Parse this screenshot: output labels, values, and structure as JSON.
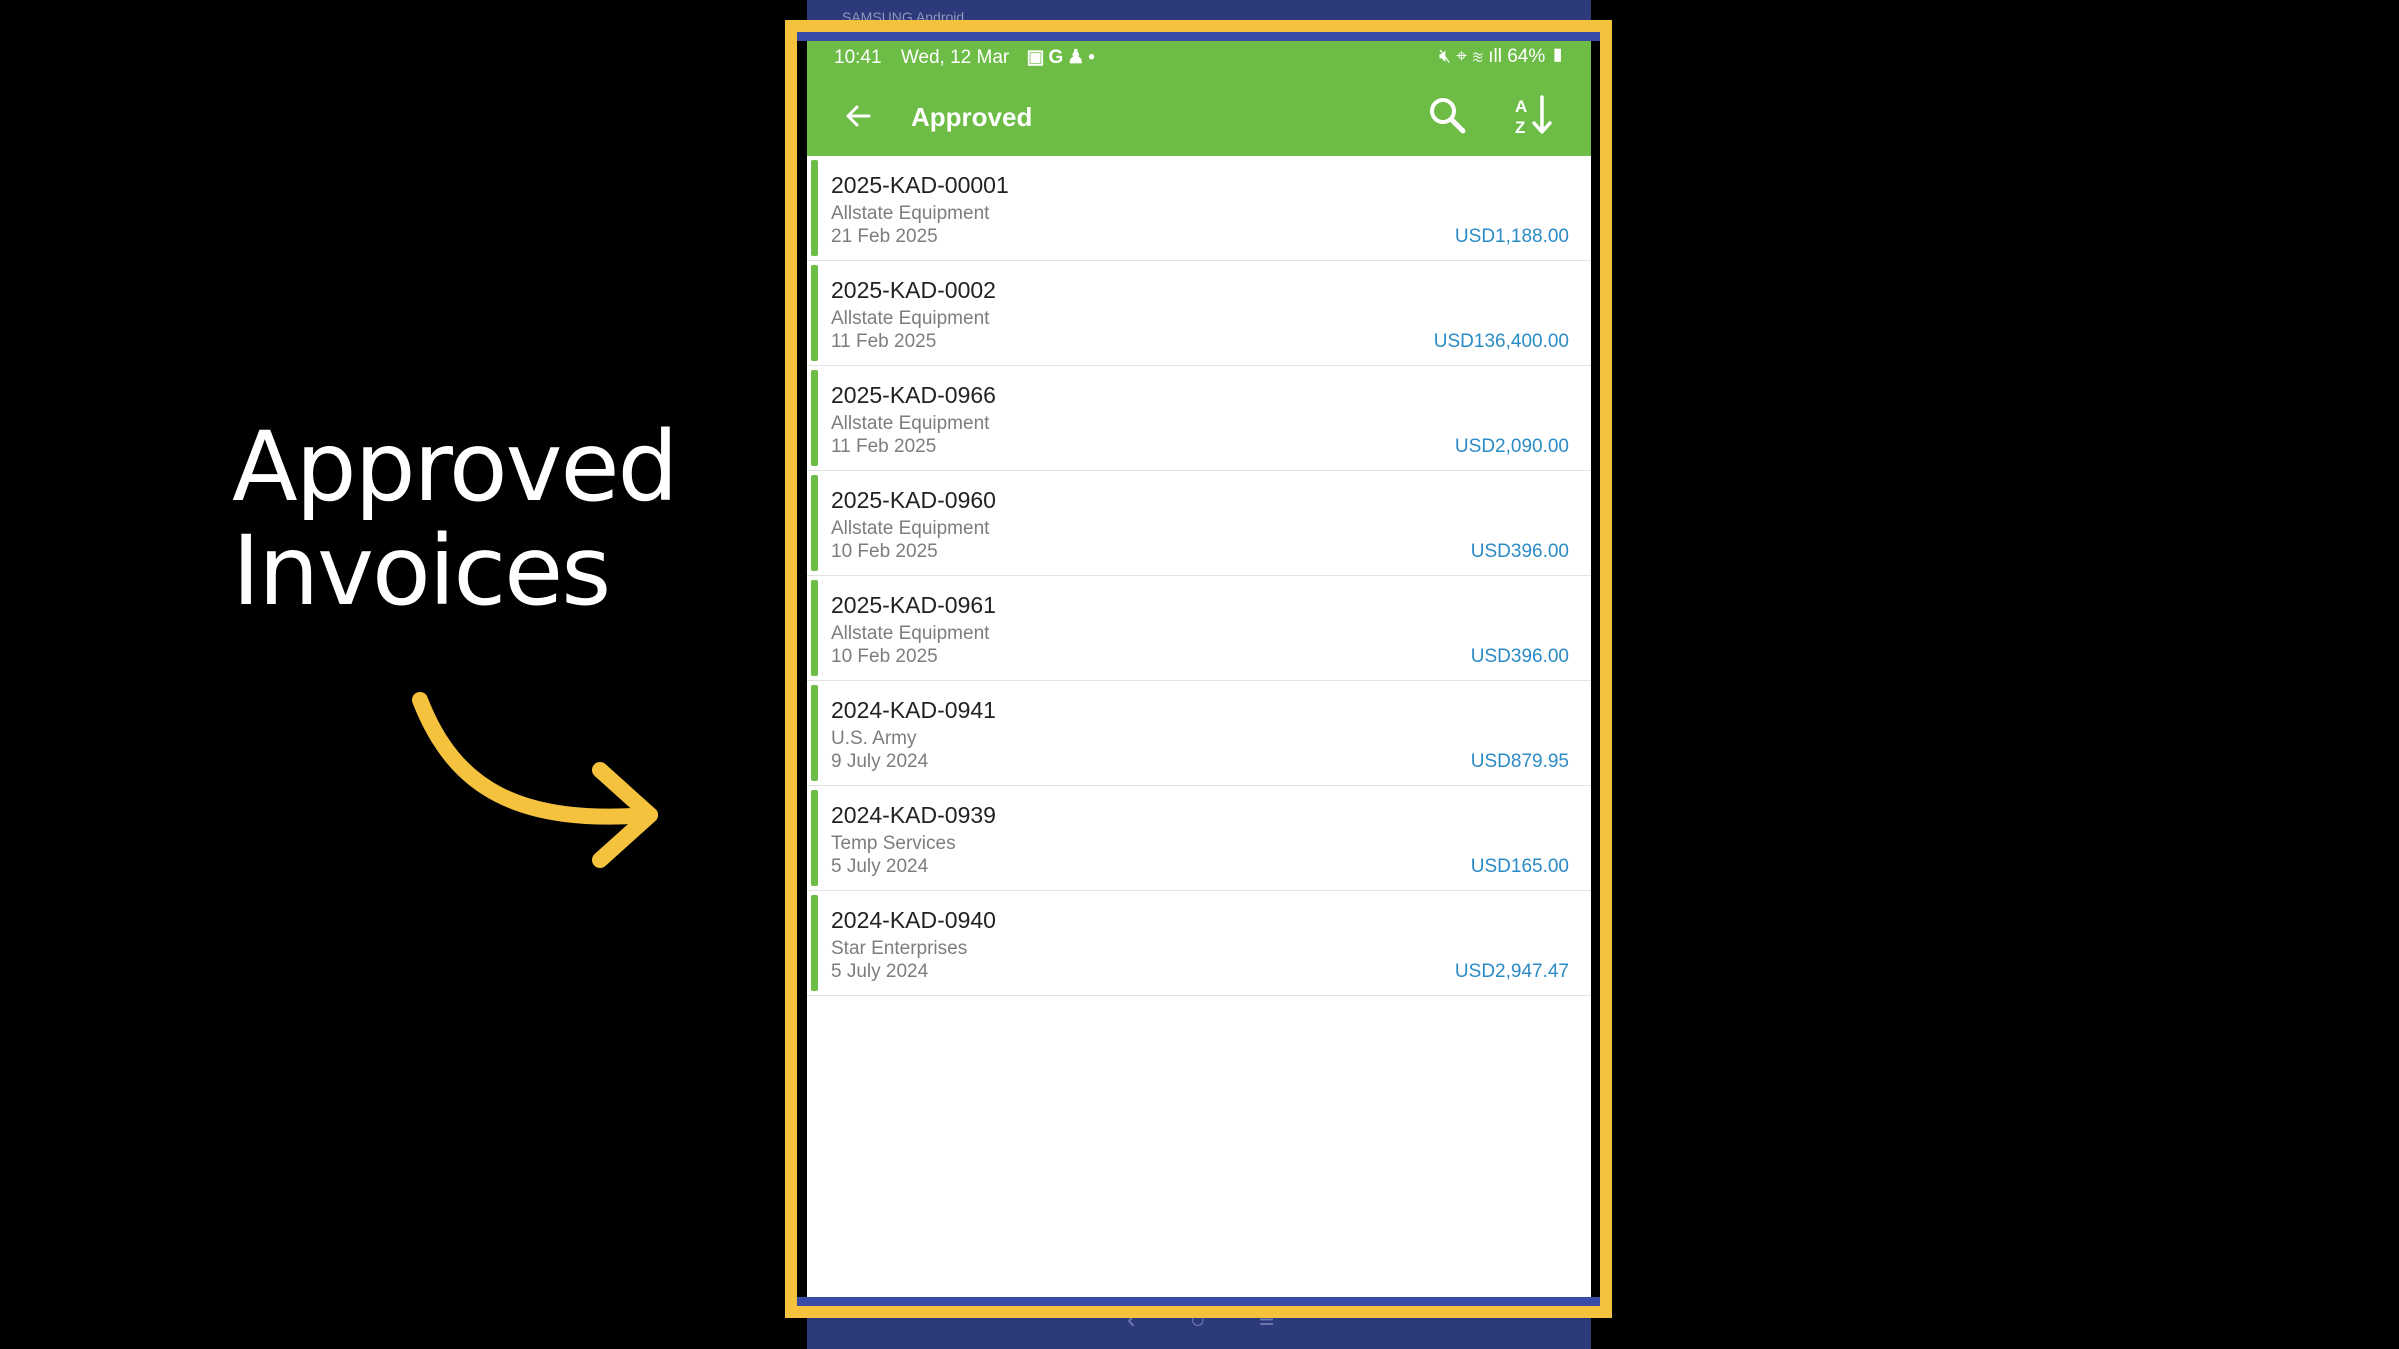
{
  "caption": {
    "line1": "Approved",
    "line2": "Invoices"
  },
  "device": {
    "brand": "SAMSUNG  Android",
    "nav": {
      "back": "‹",
      "home": "○",
      "recents": "≡"
    }
  },
  "status_bar": {
    "time": "10:41",
    "date": "Wed, 12 Mar",
    "battery": "64%"
  },
  "app_bar": {
    "title": "Approved"
  },
  "invoices": [
    {
      "number": "2025-KAD-00001",
      "vendor": "Allstate Equipment",
      "date": "21 Feb 2025",
      "amount": "USD1,188.00"
    },
    {
      "number": "2025-KAD-0002",
      "vendor": "Allstate Equipment",
      "date": "11 Feb 2025",
      "amount": "USD136,400.00"
    },
    {
      "number": "2025-KAD-0966",
      "vendor": "Allstate Equipment",
      "date": "11 Feb 2025",
      "amount": "USD2,090.00"
    },
    {
      "number": "2025-KAD-0960",
      "vendor": "Allstate Equipment",
      "date": "10 Feb 2025",
      "amount": "USD396.00"
    },
    {
      "number": "2025-KAD-0961",
      "vendor": "Allstate Equipment",
      "date": "10 Feb 2025",
      "amount": "USD396.00"
    },
    {
      "number": "2024-KAD-0941",
      "vendor": "U.S. Army",
      "date": "9 July 2024",
      "amount": "USD879.95"
    },
    {
      "number": "2024-KAD-0939",
      "vendor": "Temp Services",
      "date": "5 July 2024",
      "amount": "USD165.00"
    },
    {
      "number": "2024-KAD-0940",
      "vendor": "Star Enterprises",
      "date": "5 July 2024",
      "amount": "USD2,947.47"
    }
  ],
  "colors": {
    "accent_green": "#6cbc45",
    "amount_blue": "#2a8bc6",
    "frame_yellow": "#f5c23e",
    "device_blue": "#2c3a7c"
  }
}
